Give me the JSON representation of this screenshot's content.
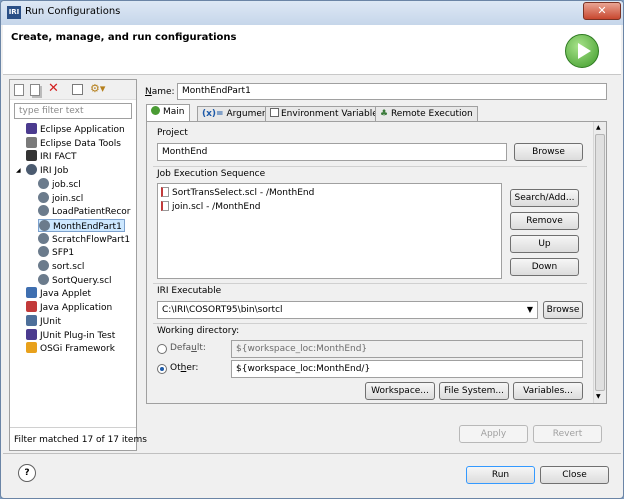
{
  "window": {
    "title": "Run Configurations",
    "title_icon": "IRI",
    "close": "✕"
  },
  "header": {
    "title": "Create, manage, and run configurations"
  },
  "toolbar": {
    "icons": [
      "new-config-icon",
      "duplicate-icon",
      "delete-icon",
      "collapse-all-icon",
      "filter-icon"
    ]
  },
  "filter": {
    "placeholder": "type filter text"
  },
  "tree": [
    {
      "label": "Eclipse Application",
      "level": 1,
      "icon": "eclipse-app-icon"
    },
    {
      "label": "Eclipse Data Tools",
      "level": 1,
      "icon": "data-tools-icon"
    },
    {
      "label": "IRI FACT",
      "level": 1,
      "icon": "iri-fact-icon"
    },
    {
      "label": "IRI Job",
      "level": 1,
      "icon": "iri-job-icon",
      "expanded": true
    },
    {
      "label": "job.scl",
      "level": 2,
      "icon": "scl-icon"
    },
    {
      "label": "join.scl",
      "level": 2,
      "icon": "scl-icon"
    },
    {
      "label": "LoadPatientRecor",
      "level": 2,
      "icon": "scl-icon"
    },
    {
      "label": "MonthEndPart1",
      "level": 2,
      "icon": "scl-icon",
      "selected": true
    },
    {
      "label": "ScratchFlowPart1",
      "level": 2,
      "icon": "scl-icon"
    },
    {
      "label": "SFP1",
      "level": 2,
      "icon": "scl-icon"
    },
    {
      "label": "sort.scl",
      "level": 2,
      "icon": "scl-icon"
    },
    {
      "label": "SortQuery.scl",
      "level": 2,
      "icon": "scl-icon"
    },
    {
      "label": "Java Applet",
      "level": 1,
      "icon": "java-applet-icon"
    },
    {
      "label": "Java Application",
      "level": 1,
      "icon": "java-app-icon"
    },
    {
      "label": "JUnit",
      "level": 1,
      "icon": "junit-icon"
    },
    {
      "label": "JUnit Plug-in Test",
      "level": 1,
      "icon": "junit-plugin-icon"
    },
    {
      "label": "OSGi Framework",
      "level": 1,
      "icon": "osgi-icon"
    }
  ],
  "filter_status": "Filter matched 17 of 17 items",
  "name": {
    "label": "Name:",
    "value": "MonthEndPart1"
  },
  "tabs": [
    "Main",
    "Arguments",
    "Environment Variables",
    "Remote Execution"
  ],
  "main": {
    "project_label": "Project",
    "project_value": "MonthEnd",
    "browse1": "Browse",
    "sequence_label": "Job Execution Sequence",
    "sequence": [
      "SortTransSelect.scl - /MonthEnd",
      "join.scl - /MonthEnd"
    ],
    "search_add": "Search/Add...",
    "remove": "Remove",
    "up": "Up",
    "down": "Down",
    "exe_label": "IRI Executable",
    "exe_value": "C:\\IRI\\COSORT95\\bin\\sortcl",
    "browse2": "Browse",
    "wd_label": "Working directory:",
    "default_label": "Default:",
    "default_value": "${workspace_loc:MonthEnd}",
    "other_label": "Other:",
    "other_value": "${workspace_loc:MonthEnd/}",
    "workspace": "Workspace...",
    "filesystem": "File System...",
    "variables": "Variables..."
  },
  "apply": "Apply",
  "revert": "Revert",
  "run": "Run",
  "close": "Close",
  "help": "?",
  "colors": {
    "accent": "#3399ff",
    "selection": "#cde8ff",
    "run_green": "#3e9a2a"
  }
}
